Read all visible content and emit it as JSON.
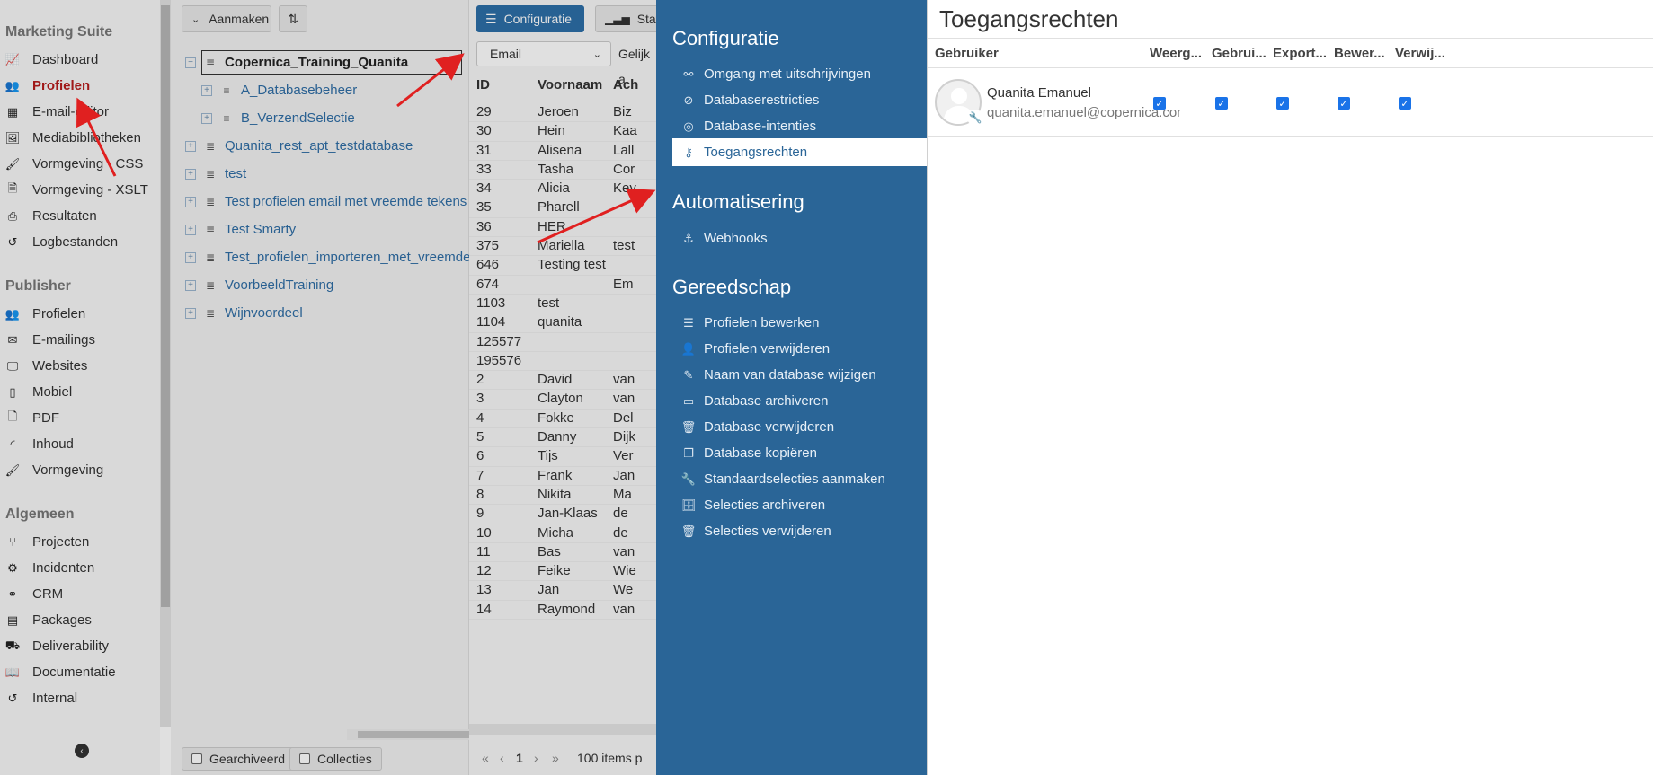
{
  "nav": {
    "sections": [
      {
        "title": "Marketing Suite",
        "items": [
          {
            "label": "Dashboard",
            "icon": "chart-line-icon"
          },
          {
            "label": "Profielen",
            "icon": "users-icon",
            "active": true
          },
          {
            "label": "E-mail-editor",
            "icon": "grid-icon"
          },
          {
            "label": "Mediabibliotheken",
            "icon": "image-icon"
          },
          {
            "label": "Vormgeving - CSS",
            "icon": "brush-icon"
          },
          {
            "label": "Vormgeving - XSLT",
            "icon": "file-code-icon"
          },
          {
            "label": "Resultaten",
            "icon": "inbox-icon"
          },
          {
            "label": "Logbestanden",
            "icon": "history-icon"
          }
        ]
      },
      {
        "title": "Publisher",
        "items": [
          {
            "label": "Profielen",
            "icon": "users-icon"
          },
          {
            "label": "E-mailings",
            "icon": "envelope-icon"
          },
          {
            "label": "Websites",
            "icon": "monitor-icon"
          },
          {
            "label": "Mobiel",
            "icon": "mobile-icon"
          },
          {
            "label": "PDF",
            "icon": "pdf-icon"
          },
          {
            "label": "Inhoud",
            "icon": "rss-icon"
          },
          {
            "label": "Vormgeving",
            "icon": "brush-icon"
          }
        ]
      },
      {
        "title": "Algemeen",
        "items": [
          {
            "label": "Projecten",
            "icon": "branch-icon"
          },
          {
            "label": "Incidenten",
            "icon": "bicycle-icon"
          },
          {
            "label": "CRM",
            "icon": "handshake-icon"
          },
          {
            "label": "Packages",
            "icon": "id-card-icon"
          },
          {
            "label": "Deliverability",
            "icon": "truck-icon"
          },
          {
            "label": "Documentatie",
            "icon": "book-icon"
          },
          {
            "label": "Internal",
            "icon": "history-icon"
          }
        ]
      }
    ]
  },
  "tree_toolbar": {
    "create_label": "Aanmaken"
  },
  "tree": [
    {
      "label": "Copernica_Training_Quanita",
      "level": 0,
      "expand": "−",
      "icon": "database-icon",
      "selected": true
    },
    {
      "label": "A_Databasebeheer",
      "level": 1,
      "expand": "+",
      "icon": "collection-icon"
    },
    {
      "label": "B_VerzendSelectie",
      "level": 1,
      "expand": "+",
      "icon": "collection-icon"
    },
    {
      "label": "Quanita_rest_apt_testdatabase",
      "level": 0,
      "expand": "+",
      "icon": "database-icon"
    },
    {
      "label": "test",
      "level": 0,
      "expand": "+",
      "icon": "database-icon"
    },
    {
      "label": "Test profielen email met vreemde tekens",
      "level": 0,
      "expand": "+",
      "icon": "database-icon"
    },
    {
      "label": "Test Smarty",
      "level": 0,
      "expand": "+",
      "icon": "database-icon"
    },
    {
      "label": "Test_profielen_importeren_met_vreemde",
      "level": 0,
      "expand": "+",
      "icon": "database-icon"
    },
    {
      "label": "VoorbeeldTraining",
      "level": 0,
      "expand": "+",
      "icon": "database-icon"
    },
    {
      "label": "Wijnvoordeel",
      "level": 0,
      "expand": "+",
      "icon": "database-icon"
    }
  ],
  "tree_footer": {
    "archived_label": "Gearchiveerd",
    "collections_label": "Collecties"
  },
  "table_toolbar": {
    "config_label": "Configuratie",
    "stats_label": "Statis",
    "filter_field": "Email",
    "filter_op": "Gelijk a"
  },
  "table": {
    "columns": [
      "ID",
      "Voornaam",
      "Ach"
    ],
    "rows": [
      [
        "29",
        "Jeroen",
        "Biz"
      ],
      [
        "30",
        "Hein",
        "Kaa"
      ],
      [
        "31",
        "Alisena",
        "Lall"
      ],
      [
        "33",
        "Tasha",
        "Cor"
      ],
      [
        "34",
        "Alicia",
        "Key"
      ],
      [
        "35",
        "Pharell",
        ""
      ],
      [
        "36",
        "HER",
        ""
      ],
      [
        "375",
        "Mariella",
        "test"
      ],
      [
        "646",
        "Testing test",
        ""
      ],
      [
        "674",
        "",
        "Em"
      ],
      [
        "1103",
        "test",
        ""
      ],
      [
        "1104",
        "quanita",
        ""
      ],
      [
        "125577",
        "",
        ""
      ],
      [
        "195576",
        "",
        ""
      ],
      [
        "2",
        "David",
        "van"
      ],
      [
        "3",
        "Clayton",
        "van"
      ],
      [
        "4",
        "Fokke",
        "Del"
      ],
      [
        "5",
        "Danny",
        "Dijk"
      ],
      [
        "6",
        "Tijs",
        "Ver"
      ],
      [
        "7",
        "Frank",
        "Jan"
      ],
      [
        "8",
        "Nikita",
        "Ma"
      ],
      [
        "9",
        "Jan-Klaas",
        "de"
      ],
      [
        "10",
        "Micha",
        "de"
      ],
      [
        "11",
        "Bas",
        "van"
      ],
      [
        "12",
        "Feike",
        "Wie"
      ],
      [
        "13",
        "Jan",
        "We"
      ],
      [
        "14",
        "Raymond",
        "van"
      ]
    ],
    "pager": {
      "page": "1",
      "items": "100 items p"
    }
  },
  "config": {
    "sections": [
      {
        "title": "Configuratie",
        "items": [
          {
            "label": "Omgang met uitschrijvingen",
            "icon": "unlink-icon"
          },
          {
            "label": "Databaserestricties",
            "icon": "ban-icon"
          },
          {
            "label": "Database-intenties",
            "icon": "target-icon"
          },
          {
            "label": "Toegangsrechten",
            "icon": "key-icon",
            "active": true
          }
        ]
      },
      {
        "title": "Automatisering",
        "items": [
          {
            "label": "Webhooks",
            "icon": "anchor-icon"
          }
        ]
      },
      {
        "title": "Gereedschap",
        "items": [
          {
            "label": "Profielen bewerken",
            "icon": "sliders-icon"
          },
          {
            "label": "Profielen verwijderen",
            "icon": "user-remove-icon"
          },
          {
            "label": "Naam van database wijzigen",
            "icon": "edit-icon"
          },
          {
            "label": "Database archiveren",
            "icon": "archive-icon"
          },
          {
            "label": "Database verwijderen",
            "icon": "trash-icon"
          },
          {
            "label": "Database kopiëren",
            "icon": "copy-icon"
          },
          {
            "label": "Standaardselecties aanmaken",
            "icon": "wrench-icon"
          },
          {
            "label": "Selecties archiveren",
            "icon": "file-archive-icon"
          },
          {
            "label": "Selecties verwijderen",
            "icon": "trash-icon"
          }
        ]
      }
    ]
  },
  "access": {
    "title": "Toegangsrechten",
    "headers": [
      "Gebruiker",
      "Weerg...",
      "Gebrui...",
      "Export...",
      "Bewer...",
      "Verwij..."
    ],
    "users": [
      {
        "name": "Quanita Emanuel",
        "email": "quanita.emanuel@copernica.com",
        "permissions": [
          true,
          true,
          true,
          true,
          true
        ]
      }
    ]
  },
  "colors": {
    "active_red": "#b71c1c",
    "config_blue": "#2a6597",
    "link_blue": "#2f6ea6",
    "check_blue": "#1a73e8",
    "arrow_red": "#e02020"
  }
}
